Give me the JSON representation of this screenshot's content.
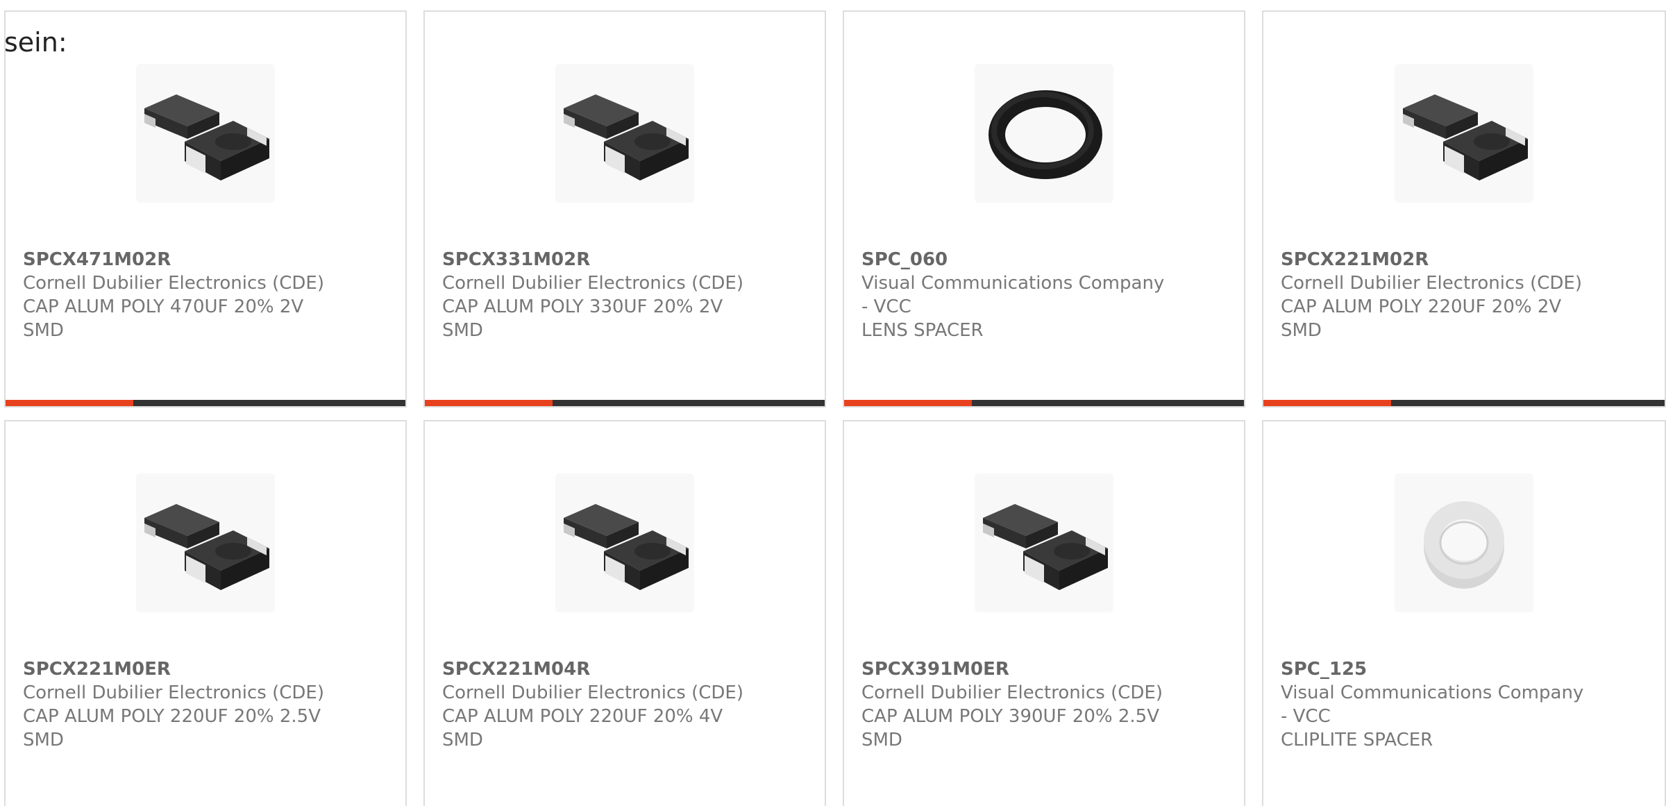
{
  "intro_text": "sein:",
  "accent_color": "#e8411d",
  "bar_color": "#333333",
  "products": [
    {
      "part_number": "SPCX471M02R",
      "manufacturer": "Cornell Dubilier Electronics (CDE)",
      "description": "CAP ALUM POLY 470UF 20% 2V\nSMD",
      "image_icon": "smd-capacitor-icon"
    },
    {
      "part_number": "SPCX331M02R",
      "manufacturer": "Cornell Dubilier Electronics (CDE)",
      "description": "CAP ALUM POLY 330UF 20% 2V\nSMD",
      "image_icon": "smd-capacitor-icon"
    },
    {
      "part_number": "SPC_060",
      "manufacturer": "Visual Communications Company\n- VCC",
      "description": "LENS SPACER",
      "image_icon": "o-ring-icon"
    },
    {
      "part_number": "SPCX221M02R",
      "manufacturer": "Cornell Dubilier Electronics (CDE)",
      "description": "CAP ALUM POLY 220UF 20% 2V\nSMD",
      "image_icon": "smd-capacitor-icon"
    },
    {
      "part_number": "SPCX221M0ER",
      "manufacturer": "Cornell Dubilier Electronics (CDE)",
      "description": "CAP ALUM POLY 220UF 20% 2.5V\nSMD",
      "image_icon": "smd-capacitor-icon"
    },
    {
      "part_number": "SPCX221M04R",
      "manufacturer": "Cornell Dubilier Electronics (CDE)",
      "description": "CAP ALUM POLY 220UF 20% 4V\nSMD",
      "image_icon": "smd-capacitor-icon"
    },
    {
      "part_number": "SPCX391M0ER",
      "manufacturer": "Cornell Dubilier Electronics (CDE)",
      "description": "CAP ALUM POLY 390UF 20% 2.5V\nSMD",
      "image_icon": "smd-capacitor-icon"
    },
    {
      "part_number": "SPC_125",
      "manufacturer": "Visual Communications Company\n- VCC",
      "description": "CLIPLITE SPACER",
      "image_icon": "spacer-ring-icon"
    }
  ]
}
